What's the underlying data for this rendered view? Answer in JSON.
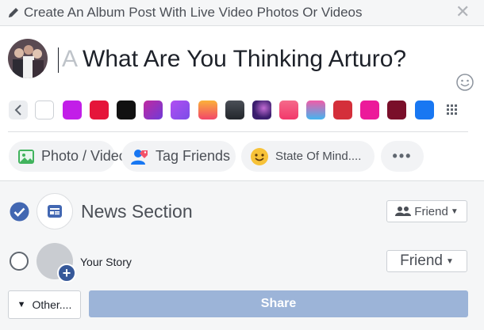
{
  "header": {
    "title": "Create An Album Post With Live Video Photos Or Videos",
    "close_glyph": "✕",
    "icons": [
      "pencil-icon",
      "close-icon"
    ]
  },
  "composer": {
    "ghost_char": "A",
    "placeholder_text": "What Are You Thinking Arturo?",
    "icons": [
      "emoji-icon"
    ]
  },
  "backgrounds": {
    "swatches": [
      {
        "name": "white",
        "color": "#ffffff"
      },
      {
        "name": "magenta",
        "color": "#c21ee8"
      },
      {
        "name": "red",
        "color": "#e5153a"
      },
      {
        "name": "black",
        "color": "#111111"
      },
      {
        "name": "purple-magenta",
        "color": "#8b2dbe"
      },
      {
        "name": "violet",
        "color": "#a855f7"
      },
      {
        "name": "orange-pink",
        "color": "#f9a034"
      },
      {
        "name": "charcoal",
        "color": "#3a3f46"
      },
      {
        "name": "galaxy",
        "color": "#3b1e6e"
      },
      {
        "name": "pink-red",
        "color": "#f2386b"
      },
      {
        "name": "blue-pink",
        "color": "#43b5f0"
      },
      {
        "name": "crimson",
        "color": "#d42f3a"
      },
      {
        "name": "hot-pink",
        "color": "#ec1a9a"
      },
      {
        "name": "maroon",
        "color": "#7a0f2a"
      },
      {
        "name": "blue",
        "color": "#1877f2"
      }
    ],
    "icons": [
      "chevron-left-icon",
      "grid-icon"
    ]
  },
  "actions": {
    "photo_video": "Photo / Video",
    "tag_friends": "Tag Friends",
    "state_of_mind": "State Of Mind....",
    "more": "•••"
  },
  "destinations": {
    "news_section": {
      "label": "News Section",
      "checked": true,
      "audience": "Friend"
    },
    "your_story": {
      "label": "Your Story",
      "checked": false,
      "audience": "Friend"
    },
    "story_plus": "+"
  },
  "footer": {
    "other_label": "Other....",
    "share_label": "Share"
  },
  "colors": {
    "accent": "#4267b2",
    "share_disabled": "#9cb4d8",
    "header_bg": "#f5f6f7"
  }
}
